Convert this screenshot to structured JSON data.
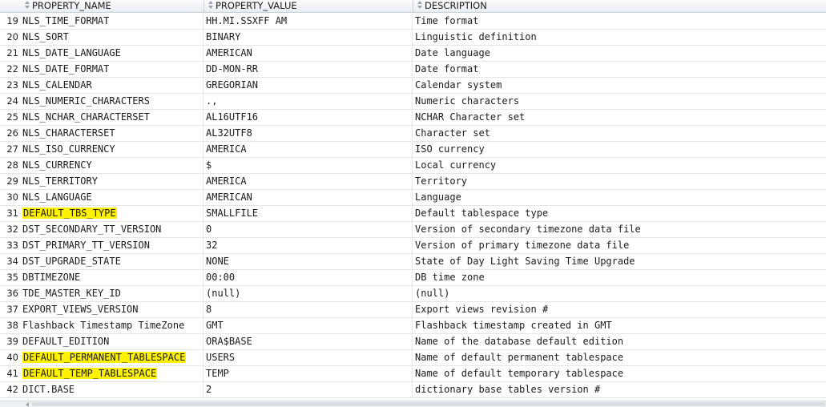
{
  "columns": [
    "PROPERTY_NAME",
    "PROPERTY_VALUE",
    "DESCRIPTION"
  ],
  "rows": [
    {
      "n": "19",
      "name": "NLS_TIME_FORMAT",
      "value": "HH.MI.SSXFF AM",
      "desc": "Time format",
      "hl": false
    },
    {
      "n": "20",
      "name": "NLS_SORT",
      "value": "BINARY",
      "desc": "Linguistic definition",
      "hl": false
    },
    {
      "n": "21",
      "name": "NLS_DATE_LANGUAGE",
      "value": "AMERICAN",
      "desc": "Date language",
      "hl": false
    },
    {
      "n": "22",
      "name": "NLS_DATE_FORMAT",
      "value": "DD-MON-RR",
      "desc": "Date format",
      "hl": false
    },
    {
      "n": "23",
      "name": "NLS_CALENDAR",
      "value": "GREGORIAN",
      "desc": "Calendar system",
      "hl": false
    },
    {
      "n": "24",
      "name": "NLS_NUMERIC_CHARACTERS",
      "value": ".,",
      "desc": "Numeric characters",
      "hl": false
    },
    {
      "n": "25",
      "name": "NLS_NCHAR_CHARACTERSET",
      "value": "AL16UTF16",
      "desc": "NCHAR Character set",
      "hl": false
    },
    {
      "n": "26",
      "name": "NLS_CHARACTERSET",
      "value": "AL32UTF8",
      "desc": "Character set",
      "hl": false
    },
    {
      "n": "27",
      "name": "NLS_ISO_CURRENCY",
      "value": "AMERICA",
      "desc": "ISO currency",
      "hl": false
    },
    {
      "n": "28",
      "name": "NLS_CURRENCY",
      "value": "$",
      "desc": "Local currency",
      "hl": false
    },
    {
      "n": "29",
      "name": "NLS_TERRITORY",
      "value": "AMERICA",
      "desc": "Territory",
      "hl": false
    },
    {
      "n": "30",
      "name": "NLS_LANGUAGE",
      "value": "AMERICAN",
      "desc": "Language",
      "hl": false
    },
    {
      "n": "31",
      "name": "DEFAULT_TBS_TYPE",
      "value": "SMALLFILE",
      "desc": "Default tablespace type",
      "hl": true
    },
    {
      "n": "32",
      "name": "DST_SECONDARY_TT_VERSION",
      "value": "0",
      "desc": "Version of secondary timezone data file",
      "hl": false
    },
    {
      "n": "33",
      "name": "DST_PRIMARY_TT_VERSION",
      "value": "32",
      "desc": "Version of primary timezone data file",
      "hl": false
    },
    {
      "n": "34",
      "name": "DST_UPGRADE_STATE",
      "value": "NONE",
      "desc": "State of Day Light Saving Time Upgrade",
      "hl": false
    },
    {
      "n": "35",
      "name": "DBTIMEZONE",
      "value": "00:00",
      "desc": "DB time zone",
      "hl": false
    },
    {
      "n": "36",
      "name": "TDE_MASTER_KEY_ID",
      "value": "(null)",
      "desc": "(null)",
      "hl": false
    },
    {
      "n": "37",
      "name": "EXPORT_VIEWS_VERSION",
      "value": "8",
      "desc": "Export views revision #",
      "hl": false
    },
    {
      "n": "38",
      "name": "Flashback Timestamp TimeZone",
      "value": "GMT",
      "desc": "Flashback timestamp created in GMT",
      "hl": false
    },
    {
      "n": "39",
      "name": "DEFAULT_EDITION",
      "value": "ORA$BASE",
      "desc": "Name of the database default edition",
      "hl": false
    },
    {
      "n": "40",
      "name": "DEFAULT_PERMANENT_TABLESPACE",
      "value": "USERS",
      "desc": "Name of default permanent tablespace",
      "hl": true
    },
    {
      "n": "41",
      "name": "DEFAULT_TEMP_TABLESPACE",
      "value": "TEMP",
      "desc": "Name of default temporary tablespace",
      "hl": true
    },
    {
      "n": "42",
      "name": "DICT.BASE",
      "value": "2",
      "desc": "dictionary base tables version #",
      "hl": false
    }
  ],
  "colors": {
    "highlight": "#fff200"
  }
}
